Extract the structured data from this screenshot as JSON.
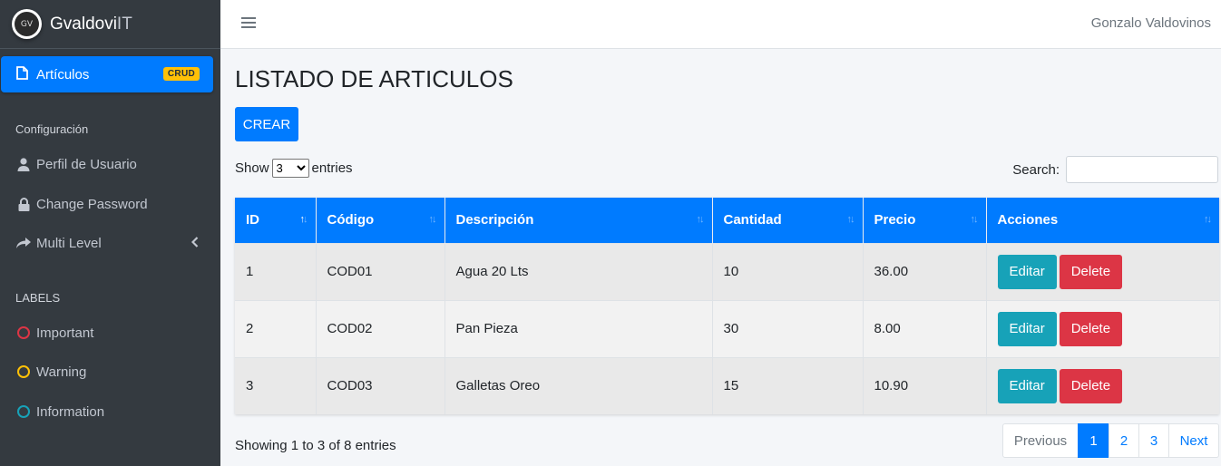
{
  "brand": {
    "logo_text": "GV",
    "name_main": "Gvaldovi",
    "name_light": "IT"
  },
  "sidebar": {
    "active_item": {
      "label": "Artículos",
      "badge": "CRUD",
      "icon": "file-icon"
    },
    "config_header": "Configuración",
    "config_items": [
      {
        "label": "Perfil de Usuario",
        "icon": "user-icon"
      },
      {
        "label": "Change Password",
        "icon": "lock-icon"
      },
      {
        "label": "Multi Level",
        "icon": "share-icon"
      }
    ],
    "labels_header": "LABELS",
    "label_items": [
      {
        "label": "Important",
        "color": "#dc3545"
      },
      {
        "label": "Warning",
        "color": "#ffc107"
      },
      {
        "label": "Information",
        "color": "#17a2b8"
      }
    ]
  },
  "topbar": {
    "user_name": "Gonzalo Valdovinos"
  },
  "main": {
    "title": "LISTADO DE ARTICULOS",
    "create_label": "CREAR",
    "show_label": "Show",
    "entries_label": "entries",
    "page_size": "3",
    "search_label": "Search:",
    "search_value": "",
    "columns": [
      "ID",
      "Código",
      "Descripción",
      "Cantidad",
      "Precio",
      "Acciones"
    ],
    "rows": [
      {
        "id": "1",
        "codigo": "COD01",
        "descripcion": "Agua 20 Lts",
        "cantidad": "10",
        "precio": "36.00"
      },
      {
        "id": "2",
        "codigo": "COD02",
        "descripcion": "Pan Pieza",
        "cantidad": "30",
        "precio": "8.00"
      },
      {
        "id": "3",
        "codigo": "COD03",
        "descripcion": "Galletas Oreo",
        "cantidad": "15",
        "precio": "10.90"
      }
    ],
    "edit_label": "Editar",
    "delete_label": "Delete",
    "info": "Showing 1 to 3 of 8 entries",
    "pagination": {
      "previous": "Previous",
      "pages": [
        "1",
        "2",
        "3"
      ],
      "next": "Next",
      "current": "1"
    }
  },
  "colors": {
    "primary": "#007bff",
    "sidebar_bg": "#343a40",
    "info": "#17a2b8",
    "danger": "#dc3545",
    "warning": "#ffc107"
  }
}
